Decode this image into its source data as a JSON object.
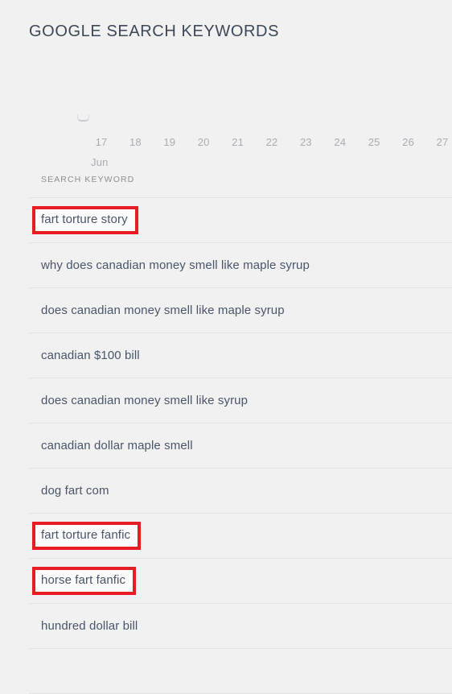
{
  "header": {
    "title": "GOOGLE SEARCH KEYWORDS"
  },
  "timeline": {
    "month_label": "Jun",
    "ticks": [
      "17",
      "18",
      "19",
      "20",
      "21",
      "22",
      "23",
      "24",
      "25",
      "26",
      "27"
    ]
  },
  "table": {
    "column_header": "SEARCH KEYWORD",
    "rows": [
      {
        "keyword": "fart torture story",
        "highlighted": true
      },
      {
        "keyword": "why does canadian money smell like maple syrup",
        "highlighted": false
      },
      {
        "keyword": "does canadian money smell like maple syrup",
        "highlighted": false
      },
      {
        "keyword": "canadian $100 bill",
        "highlighted": false
      },
      {
        "keyword": "does canadian money smell like syrup",
        "highlighted": false
      },
      {
        "keyword": "canadian dollar maple smell",
        "highlighted": false
      },
      {
        "keyword": "dog fart com",
        "highlighted": false
      },
      {
        "keyword": "fart torture fanfic",
        "highlighted": true
      },
      {
        "keyword": "horse fart fanfic",
        "highlighted": true
      },
      {
        "keyword": "hundred dollar bill",
        "highlighted": false
      },
      {
        "keyword": "",
        "highlighted": false
      }
    ]
  },
  "colors": {
    "page_background": "#f1f1f1",
    "title_text": "#3c4858",
    "row_text": "#49566a",
    "muted_text": "#a7adb4",
    "divider": "#e2e2e2",
    "highlight_border": "#e81c23"
  }
}
